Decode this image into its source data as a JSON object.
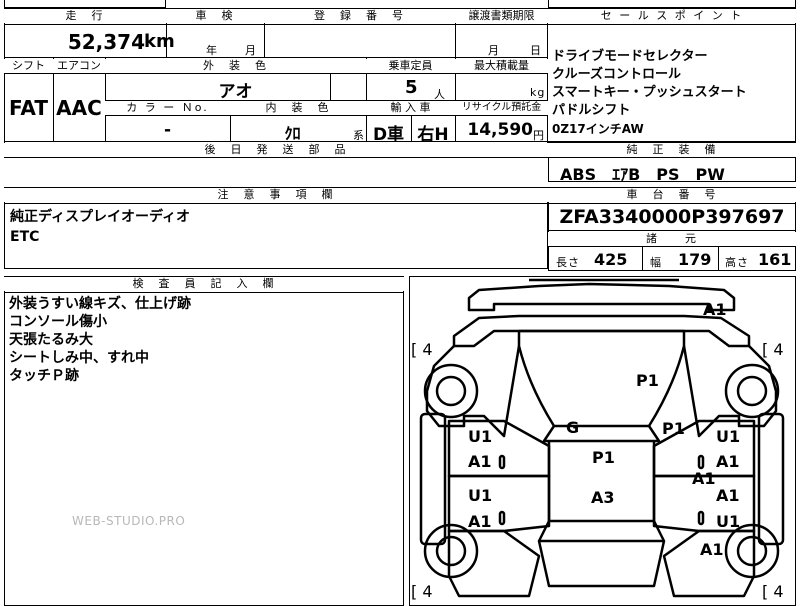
{
  "top_row": {
    "mileage_header": "走　行",
    "mileage_value": "52,374",
    "mileage_unit": "km",
    "shaken_header": "車　検",
    "shaken_year": "年",
    "shaken_month": "月",
    "reg_header": "登　録　番　号",
    "transfer_header": "譲渡書類期限",
    "transfer_month": "月",
    "transfer_day": "日"
  },
  "row2": {
    "shift_header": "シフト",
    "shift_value": "FAT",
    "ac_header": "エアコン",
    "ac_value": "AAC",
    "color_header": "外　装　色",
    "color_value": "アオ",
    "capacity_header": "乗車定員",
    "capacity_value": "5",
    "capacity_unit": "人",
    "load_header": "最大積載量",
    "load_unit": "kg",
    "colorno_header": "カ ラ ー Ｎo.",
    "colorno_value": "-",
    "interior_header": "内　装　色",
    "interior_value": "ｸﾛ",
    "interior_suffix": "系",
    "import_header": "輸 入 車",
    "import_value": "D車",
    "steering_value": "右H",
    "recycle_header": "リサイクル預託金",
    "recycle_value": "14,590",
    "recycle_unit": "円"
  },
  "later_parts_header": "後　日　発　送　部　品",
  "sales_point": {
    "header": "セ ー ル ス ポ イ ン ト",
    "lines": [
      "ドライブモードセレクター",
      "クルーズコントロール",
      "スマートキー・プッシュスタート",
      "パドルシフト",
      "0Z17インチAW"
    ]
  },
  "equipment": {
    "header": "純　正　装　備",
    "value": "ABS　ｴｱB　PS　PW"
  },
  "notes": {
    "header": "注　意　事　項　欄",
    "lines": [
      "純正ディスプレイオーディオ",
      "ETC"
    ]
  },
  "chassis": {
    "header": "車　台　番　号",
    "value": "ZFA3340000P397697"
  },
  "specs": {
    "header": "諸　　元",
    "length_label": "長さ",
    "length_value": "425",
    "width_label": "幅",
    "width_value": "179",
    "height_label": "高さ",
    "height_value": "161"
  },
  "inspector": {
    "header": "検　査　員　記　入　欄",
    "lines": [
      "外装うすい線キズ、仕上げ跡",
      "コンソール傷小",
      "天張たるみ大",
      "シートしみ中、すれ中",
      "タッチＰ跡"
    ]
  },
  "diagram": {
    "tire_fl": "[ 4",
    "tire_fr": "[ 4",
    "tire_rl": "[ 4",
    "tire_rr": "[ 4",
    "marks": {
      "a1_top": "A1",
      "p1_hood": "P1",
      "g": "G",
      "p1_right": "P1",
      "p1_roof": "P1",
      "a3": "A3",
      "u1_l1": "U1",
      "a1_l1": "A1",
      "u1_l2": "U1",
      "a1_l2": "A1",
      "u1_r1": "U1",
      "a1_r1": "A1",
      "a1_r_mid": "A1",
      "a1_r2": "A1",
      "u1_r2": "U1",
      "a1_rear": "A1"
    }
  },
  "watermark": "WEB-STUDIO.PRO"
}
